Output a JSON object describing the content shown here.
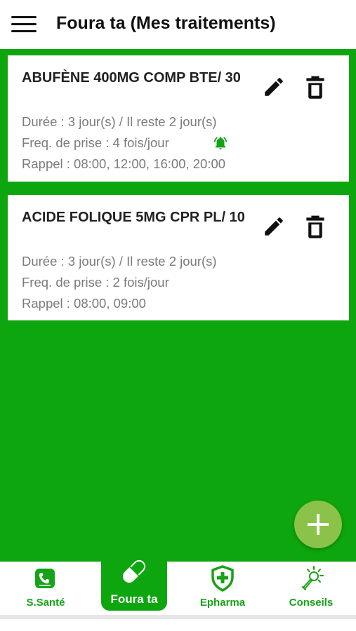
{
  "header": {
    "title": "Foura ta (Mes traitements)",
    "menu_icon": "hamburger-menu-icon"
  },
  "colors": {
    "primary_green": "#0ea60e",
    "fab_green": "#8bc34a",
    "text_dark": "#222222",
    "text_grey": "#7b7b7b"
  },
  "treatments": [
    {
      "name": "ABUFÈNE 400MG COMP BTE/ 30",
      "duration": "Durée : 3 jour(s) /  Il reste  2 jour(s)",
      "frequency": "Freq. de prise : 4 fois/jour",
      "reminder": "Rappel : 08:00, 12:00, 16:00, 20:00",
      "alarm_icon": "alarm-bell-icon",
      "edit_icon": "pencil-icon",
      "delete_icon": "trash-icon"
    },
    {
      "name": "ACIDE FOLIQUE 5MG CPR PL/ 10",
      "duration": "Durée : 3 jour(s) /  Il reste  2 jour(s)",
      "frequency": "Freq. de prise : 2 fois/jour",
      "reminder": "Rappel : 08:00, 09:00",
      "edit_icon": "pencil-icon",
      "delete_icon": "trash-icon"
    }
  ],
  "fab": {
    "icon": "plus-icon"
  },
  "bottom_nav": [
    {
      "label": "S.Santé",
      "icon": "phone-app-icon",
      "active": false
    },
    {
      "label": "Foura ta",
      "icon": "pill-capsule-icon",
      "active": true
    },
    {
      "label": "Epharma",
      "icon": "shield-cross-icon",
      "active": false
    },
    {
      "label": "Conseils",
      "icon": "lightbulb-icon",
      "active": false
    }
  ]
}
